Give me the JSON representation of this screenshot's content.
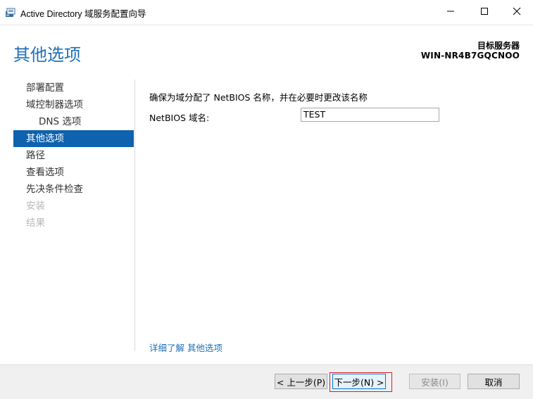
{
  "window": {
    "title": "Active Directory 域服务配置向导",
    "icon": "ad-ds-icon",
    "controls": [
      "minimize-icon",
      "maximize-icon",
      "close-icon"
    ]
  },
  "header": {
    "heading": "其他选项",
    "target_label": "目标服务器",
    "target_name": "WIN-NR4B7GQCNOO"
  },
  "nav": {
    "items": [
      {
        "label": "部署配置",
        "state": "normal"
      },
      {
        "label": "域控制器选项",
        "state": "normal"
      },
      {
        "label": "DNS 选项",
        "state": "normal",
        "sub": true
      },
      {
        "label": "其他选项",
        "state": "active"
      },
      {
        "label": "路径",
        "state": "normal"
      },
      {
        "label": "查看选项",
        "state": "normal"
      },
      {
        "label": "先决条件检查",
        "state": "normal"
      },
      {
        "label": "安装",
        "state": "disabled"
      },
      {
        "label": "结果",
        "state": "disabled"
      }
    ]
  },
  "main": {
    "description": "确保为域分配了 NetBIOS 名称，并在必要时更改该名称",
    "netbios_label": "NetBIOS 域名:",
    "netbios_value": "TEST",
    "learn_more": "详细了解 其他选项"
  },
  "buttons": {
    "prev": "< 上一步(P)",
    "next": "下一步(N) >",
    "install": "安装(I)",
    "cancel": "取消"
  },
  "colors": {
    "accent": "#0f62ad",
    "heading": "#1e6fb8",
    "focus": "#d0202a"
  }
}
